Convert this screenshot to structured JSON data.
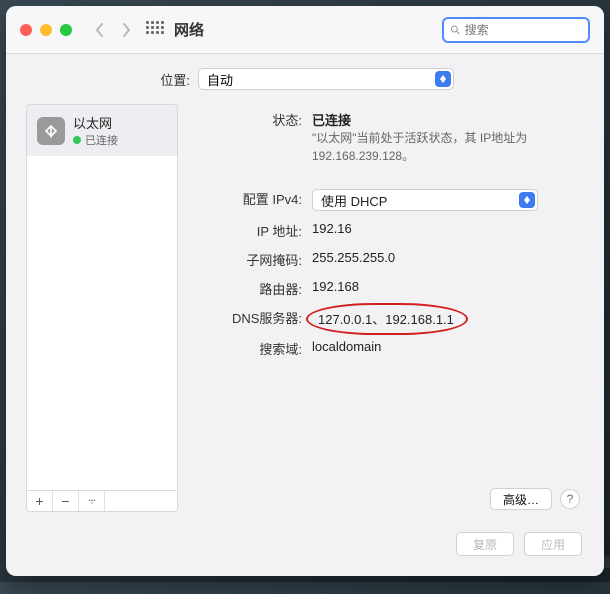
{
  "window": {
    "title": "网络"
  },
  "search": {
    "placeholder": "搜索"
  },
  "location": {
    "label": "位置:",
    "value": "自动"
  },
  "sidebar": {
    "items": [
      {
        "name": "以太网",
        "status": "已连接"
      }
    ]
  },
  "detail": {
    "status_label": "状态:",
    "status_value": "已连接",
    "status_desc": "\"以太网\"当前处于活跃状态，其 IP地址为 192.168.239.128。",
    "ipv4_label": "配置 IPv4:",
    "ipv4_value": "使用 DHCP",
    "ip_label": "IP 地址:",
    "ip_value": "192.16",
    "subnet_label": "子网掩码:",
    "subnet_value": "255.255.255.0",
    "router_label": "路由器:",
    "router_value": "192.168",
    "dns_label": "DNS服务器:",
    "dns_value": "127.0.0.1、192.168.1.1",
    "search_label": "搜索域:",
    "search_value": "localdomain"
  },
  "buttons": {
    "advanced": "高级…",
    "help": "?",
    "revert": "复原",
    "apply": "应用"
  }
}
